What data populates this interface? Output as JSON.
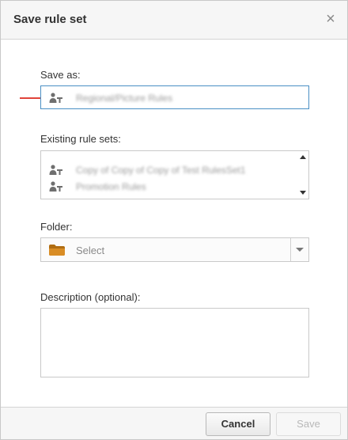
{
  "dialog": {
    "title": "Save rule set",
    "close_glyph": "×"
  },
  "save_as": {
    "label": "Save as:",
    "value": "Regional/Picture Rules"
  },
  "existing": {
    "label": "Existing rule sets:",
    "items": [
      {
        "name": "Copy of Copy of Copy of Test RulesSet1"
      },
      {
        "name": "Promotion Rules"
      }
    ]
  },
  "folder": {
    "label": "Folder:",
    "placeholder": "Select"
  },
  "description": {
    "label": "Description (optional):",
    "value": ""
  },
  "footer": {
    "cancel_label": "Cancel",
    "save_label": "Save"
  },
  "colors": {
    "accent_focus": "#4a8fc4",
    "pointer": "#e0443a",
    "folder_icon": "#c9821c"
  }
}
